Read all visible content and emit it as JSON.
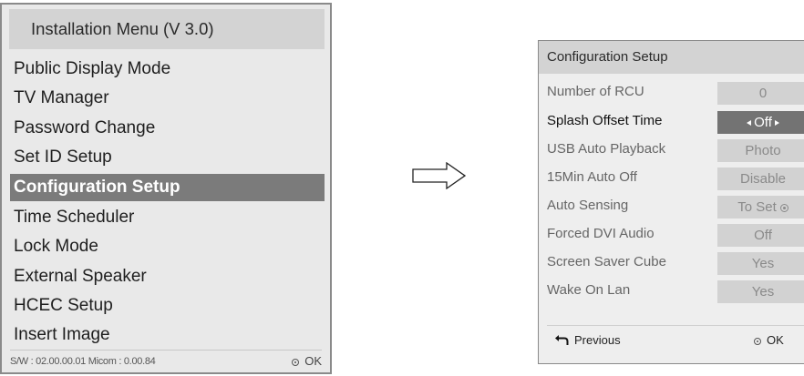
{
  "install_menu": {
    "title": "Installation Menu (V 3.0)",
    "items": [
      {
        "label": "Public Display Mode",
        "selected": false
      },
      {
        "label": "TV Manager",
        "selected": false
      },
      {
        "label": "Password Change",
        "selected": false
      },
      {
        "label": "Set ID Setup",
        "selected": false
      },
      {
        "label": "Configuration Setup",
        "selected": true
      },
      {
        "label": "Time Scheduler",
        "selected": false
      },
      {
        "label": "Lock Mode",
        "selected": false
      },
      {
        "label": "External Speaker",
        "selected": false
      },
      {
        "label": "HCEC Setup",
        "selected": false
      },
      {
        "label": "Insert Image",
        "selected": false
      }
    ],
    "footer": {
      "version": "S/W : 02.00.00.01  Micom : 0.00.84",
      "ok_label": "OK"
    }
  },
  "arrow_icon": "right-outline-arrow-icon",
  "config_setup": {
    "title": "Configuration Setup",
    "rows": [
      {
        "label": "Number of RCU",
        "value": "0"
      },
      {
        "label": "Splash Offset Time",
        "value": "Off"
      },
      {
        "label": "USB Auto Playback",
        "value": "Photo"
      },
      {
        "label": "15Min Auto Off",
        "value": "Disable"
      },
      {
        "label": "Auto Sensing",
        "value": "To Set"
      },
      {
        "label": "Forced DVI Audio",
        "value": "Off"
      },
      {
        "label": "Screen Saver Cube",
        "value": "Yes"
      },
      {
        "label": "Wake On Lan",
        "value": "Yes"
      }
    ],
    "footer": {
      "previous_label": "Previous",
      "ok_label": "OK"
    }
  },
  "colors": {
    "selected_bg": "#7b7b7b",
    "panel_bg": "#e9e9e9",
    "header_bg": "#d3d3d3",
    "value_bg": "#d2d2d2"
  }
}
